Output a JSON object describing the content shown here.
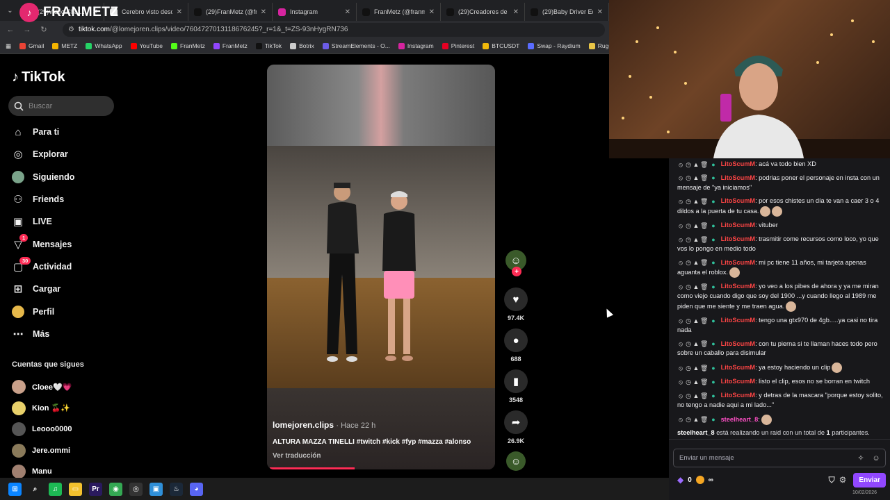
{
  "browser": {
    "tabs": [
      {
        "title": "(29)Video Chat...",
        "color": "#e4286f"
      },
      {
        "title": "Cerebro visto desde a...",
        "color": "#e8e8e8"
      },
      {
        "title": "(29)FranMetz (@fran...",
        "color": "#111111"
      },
      {
        "title": "Instagram",
        "color": "#d6249f"
      },
      {
        "title": "FranMetz (@franmetz...",
        "color": "#111111"
      },
      {
        "title": "(29)Creadores de Mo...",
        "color": "#111111"
      },
      {
        "title": "(29)Baby Driver Editi...",
        "color": "#111111"
      }
    ],
    "url_host": "tiktok.com",
    "url_path": "/@lomejoren.clips/video/7604727013118676245?_r=1&_t=ZS-93nHygRN736",
    "bookmarks": [
      {
        "label": "Gmail",
        "color": "#ea4335"
      },
      {
        "label": "METZ",
        "color": "#f4b400"
      },
      {
        "label": "WhatsApp",
        "color": "#25d366"
      },
      {
        "label": "YouTube",
        "color": "#ff0000"
      },
      {
        "label": "FranMetz",
        "color": "#53fc18"
      },
      {
        "label": "FranMetz",
        "color": "#9146ff"
      },
      {
        "label": "TikTok",
        "color": "#111111"
      },
      {
        "label": "Botrix",
        "color": "#cccccc"
      },
      {
        "label": "StreamElements - O...",
        "color": "#6c5ce7"
      },
      {
        "label": "Instagram",
        "color": "#d6249f"
      },
      {
        "label": "Pinterest",
        "color": "#e60023"
      },
      {
        "label": "BTCUSDT",
        "color": "#f0b90b"
      },
      {
        "label": "Swap - Raydium",
        "color": "#5a6cff"
      },
      {
        "label": "RugCheck",
        "color": "#e8c547"
      }
    ]
  },
  "overlay_name": "FRANMETZ",
  "tiktok": {
    "logo": "TikTok",
    "search_placeholder": "Buscar",
    "nav": [
      {
        "label": "Para ti",
        "icon": "home-icon",
        "badge": ""
      },
      {
        "label": "Explorar",
        "icon": "compass-icon",
        "badge": ""
      },
      {
        "label": "Siguiendo",
        "icon": "avatar-icon",
        "badge": ""
      },
      {
        "label": "Friends",
        "icon": "friends-icon",
        "badge": ""
      },
      {
        "label": "LIVE",
        "icon": "live-icon",
        "badge": ""
      },
      {
        "label": "Mensajes",
        "icon": "inbox-icon",
        "badge": "1"
      },
      {
        "label": "Actividad",
        "icon": "activity-icon",
        "badge": "30"
      },
      {
        "label": "Cargar",
        "icon": "upload-icon",
        "badge": ""
      },
      {
        "label": "Perfil",
        "icon": "profile-icon",
        "badge": ""
      },
      {
        "label": "Más",
        "icon": "more-icon",
        "badge": ""
      }
    ],
    "following_title": "Cuentas que sigues",
    "following": [
      {
        "name": "Cloee🤍💗",
        "color": "#c9a08a"
      },
      {
        "name": "Kion 🍒✨",
        "color": "#e8d06a"
      },
      {
        "name": "Leooo0000",
        "color": "#555555"
      },
      {
        "name": "Jere.ommi",
        "color": "#8a7a5a"
      },
      {
        "name": "Manu",
        "color": "#a08070"
      }
    ]
  },
  "video": {
    "author": "lomejoren.clips",
    "time": "· Hace 22 h",
    "caption": "ALTURA MAZZA TINELLI #twitch #kick #fyp #mazza #alonso",
    "translate": "Ver traducción",
    "likes": "97.4K",
    "comments": "688",
    "saves": "3548",
    "shares": "26.9K"
  },
  "chat": {
    "messages": [
      {
        "user": "LitoScumM",
        "text": ": acá va todo bien XD",
        "emotes": 0
      },
      {
        "user": "LitoScumM",
        "text": ": podrias poner el personaje en insta con un mensaje de \"ya iniciamos\"",
        "emotes": 0
      },
      {
        "user": "LitoScumM",
        "text": ": por esos chistes un día te van a caer 3 o 4 dildos a la puerta de tu casa.",
        "emotes": 2
      },
      {
        "user": "LitoScumM",
        "text": ": vituber",
        "emotes": 0
      },
      {
        "user": "LitoScumM",
        "text": ": trasmitir come recursos como loco, yo que vos lo pongo en medio todo",
        "emotes": 0
      },
      {
        "user": "LitoScumM",
        "text": ": mi pc tiene 11 años, mi tarjeta apenas aguanta el roblox.",
        "emotes": 1
      },
      {
        "user": "LitoScumM",
        "text": ": yo veo a los pibes de ahora y ya me miran como viejo cuando digo que soy del 1900 ...y cuando llego al 1989 me piden que me siente y me traen agua.",
        "emotes": 1
      },
      {
        "user": "LitoScumM",
        "text": ": tengo una gtx970 de 4gb.....ya casi no tira nada",
        "emotes": 0
      },
      {
        "user": "LitoScumM",
        "text": ": con tu pierna si te llaman haces todo pero sobre un caballo para disimular",
        "emotes": 0
      },
      {
        "user": "LitoScumM",
        "text": ": ya estoy haciendo un clip",
        "emotes": 1
      },
      {
        "user": "LitoScumM",
        "text": ": listo el clip, esos no se borran en twitch",
        "emotes": 0
      },
      {
        "user": "LitoScumM",
        "text": ": y detras de la mascara \"porque estoy solito, no tengo a nadie aqui a mi lado...\"",
        "emotes": 0
      },
      {
        "user": "steelheart_8",
        "text": ":",
        "emotes": 1
      }
    ],
    "raid_user": "steelheart_8",
    "raid_text_a": " está realizando un raid con un total de ",
    "raid_count": "1",
    "raid_text_b": " participantes.",
    "input_placeholder": "Enviar un mensaje",
    "points": "0",
    "points_infinite": "∞",
    "send_label": "Enviar"
  },
  "taskbar": {
    "apps": [
      {
        "name": "windows-start-icon",
        "glyph": "⊞",
        "color": "#0a84ff"
      },
      {
        "name": "search-icon",
        "glyph": "⌕",
        "color": "#1c1c1c"
      },
      {
        "name": "spotify-icon",
        "glyph": "♫",
        "color": "#1db954"
      },
      {
        "name": "file-explorer-icon",
        "glyph": "▭",
        "color": "#f2c12e"
      },
      {
        "name": "premiere-icon",
        "glyph": "Pr",
        "color": "#2a1a5e"
      },
      {
        "name": "chrome-icon",
        "glyph": "◉",
        "color": "#34a853"
      },
      {
        "name": "obs-icon",
        "glyph": "◎",
        "color": "#333333"
      },
      {
        "name": "app-icon",
        "glyph": "▣",
        "color": "#2f8fd8"
      },
      {
        "name": "steam-icon",
        "glyph": "♨",
        "color": "#1b2838"
      },
      {
        "name": "discord-icon",
        "glyph": "◕",
        "color": "#5865f2"
      }
    ],
    "date": "10/02/2026"
  }
}
